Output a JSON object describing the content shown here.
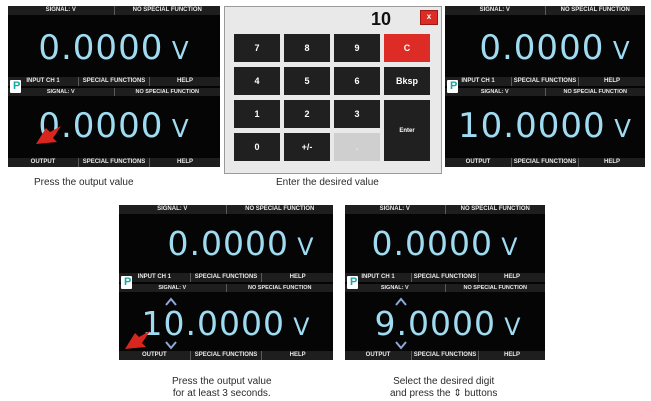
{
  "bars": {
    "signal": "SIGNAL: V",
    "function": "NO SPECIAL FUNCTION",
    "input": "INPUT CH 1",
    "output": "OUTPUT",
    "special": "SPECIAL FUNCTIONS",
    "help": "HELP"
  },
  "displays": {
    "zero": "0.0000",
    "ten": "10.0000",
    "ten_lead": "1",
    "ten_rest": "0.0000",
    "nine_digit": "9",
    "nine_rest": ".0000",
    "unit": "V"
  },
  "keypad": {
    "entry": "10",
    "close": "x",
    "keys": [
      "7",
      "8",
      "9",
      "C",
      "4",
      "5",
      "6",
      "Bksp",
      "1",
      "2",
      "3",
      "Enter",
      "0",
      "+/-",
      "."
    ]
  },
  "logo_letter": "P",
  "captions": {
    "step1": "Press the output value",
    "step2": "Enter the desired value",
    "step3_line1": "Press the output value",
    "step3_line2": "for at least 3 seconds.",
    "step4_line1": "Select the desired digit",
    "step4_line2": "and press the ⇕ buttons"
  },
  "colors": {
    "display_text": "#9fdcf2",
    "keypad_clear": "#dd2c25",
    "pointer": "#d8261f",
    "digit_arrows": "#8fa8d8"
  }
}
